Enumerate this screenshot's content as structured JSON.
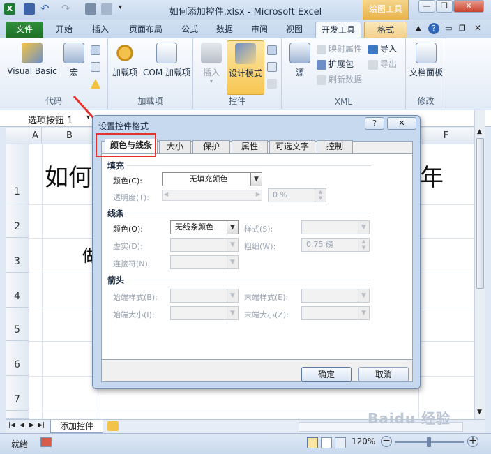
{
  "window": {
    "title": "如何添加控件.xlsx - Microsoft Excel",
    "context_tab_header": "绘图工具",
    "min": "—",
    "restore": "❐",
    "close": "✕"
  },
  "ribbon_tabs": [
    "文件",
    "开始",
    "插入",
    "页面布局",
    "公式",
    "数据",
    "审阅",
    "视图",
    "开发工具",
    "格式"
  ],
  "ribbon": {
    "code_group": {
      "label": "代码",
      "visual_basic": "Visual Basic",
      "macro": "宏"
    },
    "addins_group": {
      "label": "加载项",
      "addins": "加载项",
      "com_addins": "COM 加载项"
    },
    "controls_group": {
      "label": "控件",
      "insert": "插入",
      "design_mode": "设计模式"
    },
    "xml_group": {
      "label": "XML",
      "source": "源",
      "map_props": "映射属性",
      "expansion": "扩展包",
      "refresh": "刷新数据",
      "import": "导入",
      "export": "导出"
    },
    "modify_group": {
      "label": "修改",
      "doc_panel": "文档面板"
    }
  },
  "formula_bar": {
    "name_box": "选项按钮 1"
  },
  "sheet": {
    "columns": [
      "A",
      "B",
      "F"
    ],
    "rows": [
      "1",
      "2",
      "3",
      "4",
      "5",
      "6",
      "7"
    ],
    "cell_text_b1": "如何",
    "cell_text_b3": "做",
    "cell_tail_1": "年"
  },
  "sheet_tabs": {
    "active": "添加控件"
  },
  "status": {
    "ready": "就绪",
    "zoom": "120%"
  },
  "watermark": "Baidu 经验",
  "dialog": {
    "title": "设置控件格式",
    "help": "?",
    "close": "✕",
    "tabs": [
      "颜色与线条",
      "大小",
      "保护",
      "属性",
      "可选文字",
      "控制"
    ],
    "fill": {
      "section": "填充",
      "color_label": "颜色(C):",
      "color_value": "无填充颜色",
      "transparency_label": "透明度(T):",
      "transparency_value": "0 %"
    },
    "line": {
      "section": "线条",
      "color_label": "颜色(O):",
      "color_value": "无线条颜色",
      "style_label": "样式(S):",
      "dashed_label": "虚实(D):",
      "weight_label": "粗细(W):",
      "weight_value": "0.75 磅",
      "connector_label": "连接符(N):"
    },
    "arrows": {
      "section": "箭头",
      "begin_style": "始端样式(B):",
      "end_style": "末端样式(E):",
      "begin_size": "始端大小(I):",
      "end_size": "末端大小(Z):"
    },
    "ok": "确定",
    "cancel": "取消"
  }
}
